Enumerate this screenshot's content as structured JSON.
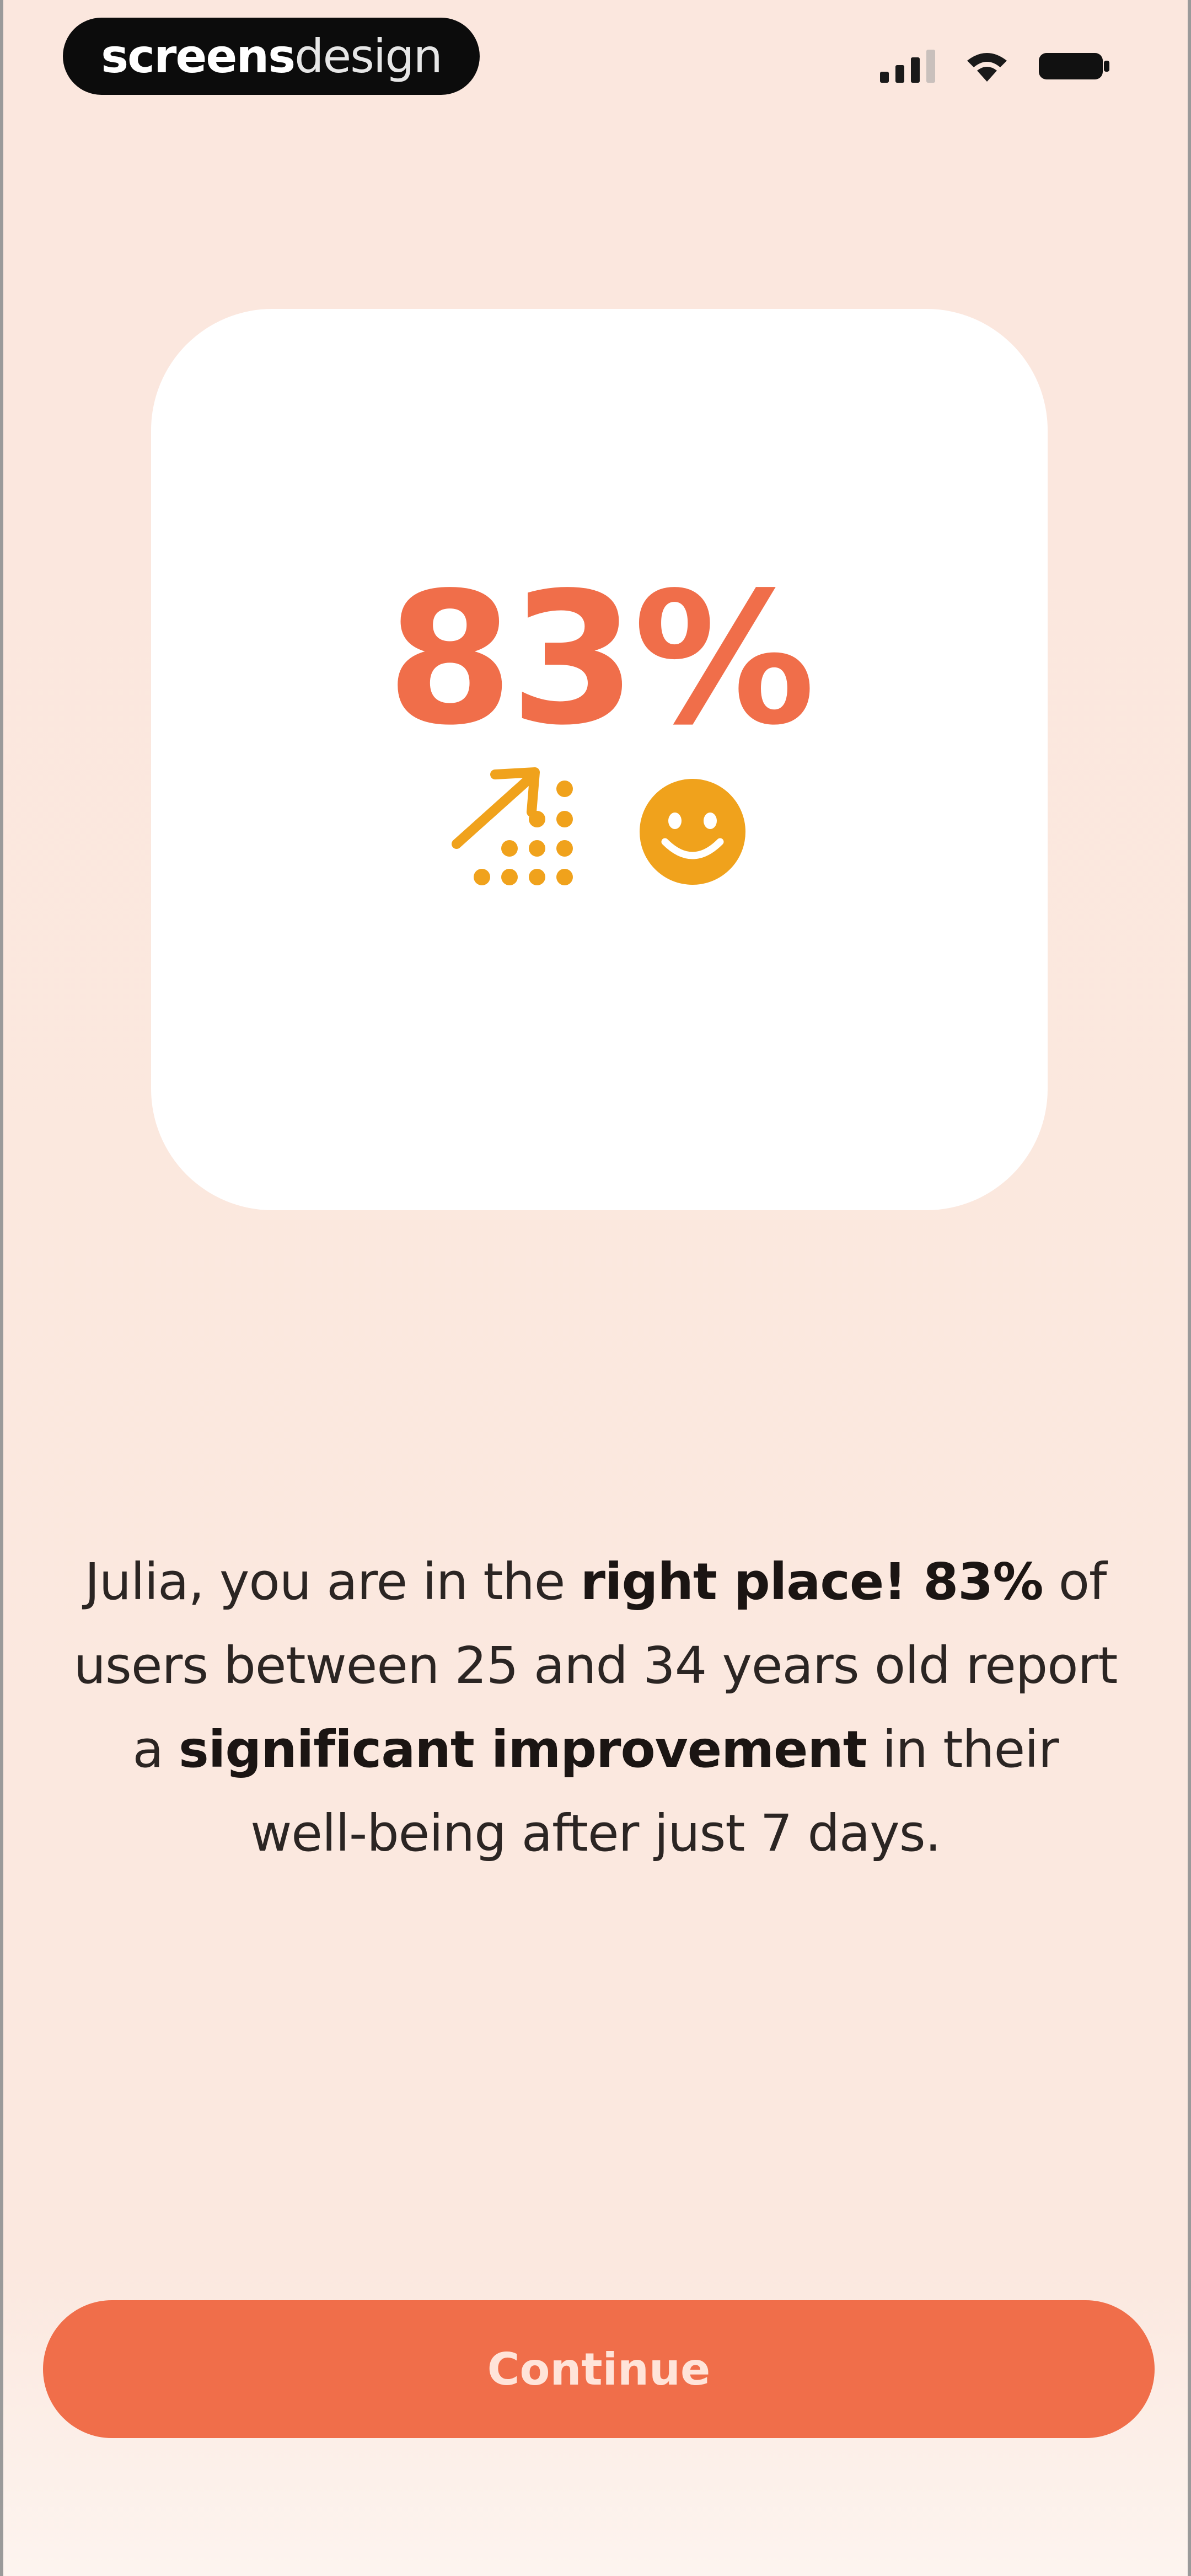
{
  "status_bar": {
    "brand_bold": "screens",
    "brand_light": "design",
    "icons": [
      "signal-icon",
      "wifi-icon",
      "battery-icon"
    ]
  },
  "hero": {
    "percent": "83%",
    "graphic_icons": [
      "growth-arrow-icon",
      "dot-grid-chart-icon",
      "smiley-face-icon"
    ],
    "accent_color": "#f0a21c",
    "percent_color": "#f06e4a"
  },
  "message": {
    "part1": "Julia, you are in the ",
    "bold1": "right place! 83%",
    "part2": " of users between 25 and 34 years old report a ",
    "bold2": "significant improvement",
    "part3": " in their well-being after just 7 days."
  },
  "actions": {
    "continue_label": "Continue",
    "button_color": "#f06e4a"
  }
}
